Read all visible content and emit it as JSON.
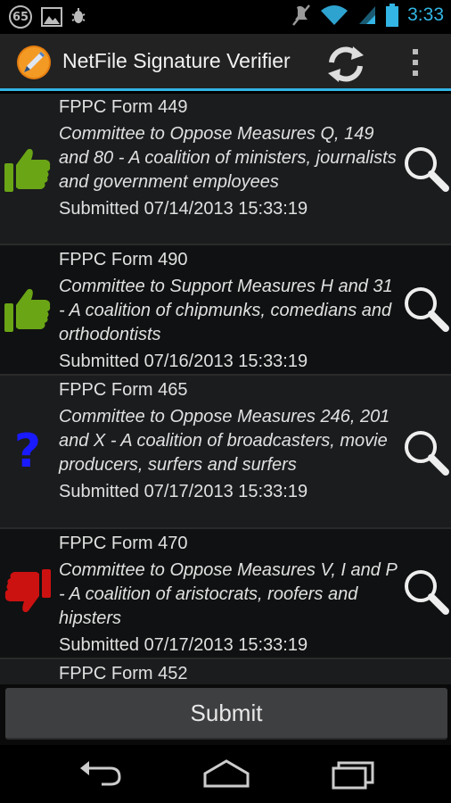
{
  "status_bar": {
    "notification_count": "65",
    "time": "3:33",
    "icons": [
      "image-icon",
      "usb-debug-icon",
      "mute-icon",
      "wifi-icon",
      "signal-icon",
      "battery-icon"
    ]
  },
  "action_bar": {
    "title": "NetFile Signature Verifier",
    "app_icon": "pen-icon",
    "actions": [
      "refresh-icon",
      "overflow-menu-icon"
    ]
  },
  "filings": [
    {
      "form": "FPPC Form 449",
      "description": "Committee to Oppose Measures Q, 149 and 80 - A coalition of ministers, journalists and government employees",
      "submitted": "Submitted 07/14/2013 15:33:19",
      "status_icon": "thumbs-up-icon",
      "status_color": "#6aa516"
    },
    {
      "form": "FPPC Form 490",
      "description": "Committee to Support Measures H and 31 - A coalition of chipmunks, comedians and orthodontists",
      "submitted": "Submitted 07/16/2013 15:33:19",
      "status_icon": "thumbs-up-icon",
      "status_color": "#6aa516"
    },
    {
      "form": "FPPC Form 465",
      "description": "Committee to Oppose Measures 246, 201 and X - A coalition of broadcasters, movie producers, surfers and surfers",
      "submitted": "Submitted 07/17/2013 15:33:19",
      "status_icon": "question-mark-icon",
      "status_color": "#1a1aff"
    },
    {
      "form": "FPPC Form 470",
      "description": "Committee to Oppose Measures V, I and P - A coalition of aristocrats, roofers and hipsters",
      "submitted": "Submitted 07/17/2013 15:33:19",
      "status_icon": "thumbs-down-icon",
      "status_color": "#cc1111"
    },
    {
      "form": "FPPC Form 452",
      "description": "",
      "submitted": "",
      "status_icon": "",
      "status_color": ""
    }
  ],
  "submit_label": "Submit",
  "nav_bar": [
    "back-icon",
    "home-icon",
    "recent-apps-icon"
  ],
  "colors": {
    "accent": "#33b5e5",
    "approved": "#6aa516",
    "unknown": "#1a1aff",
    "rejected": "#cc1111"
  }
}
